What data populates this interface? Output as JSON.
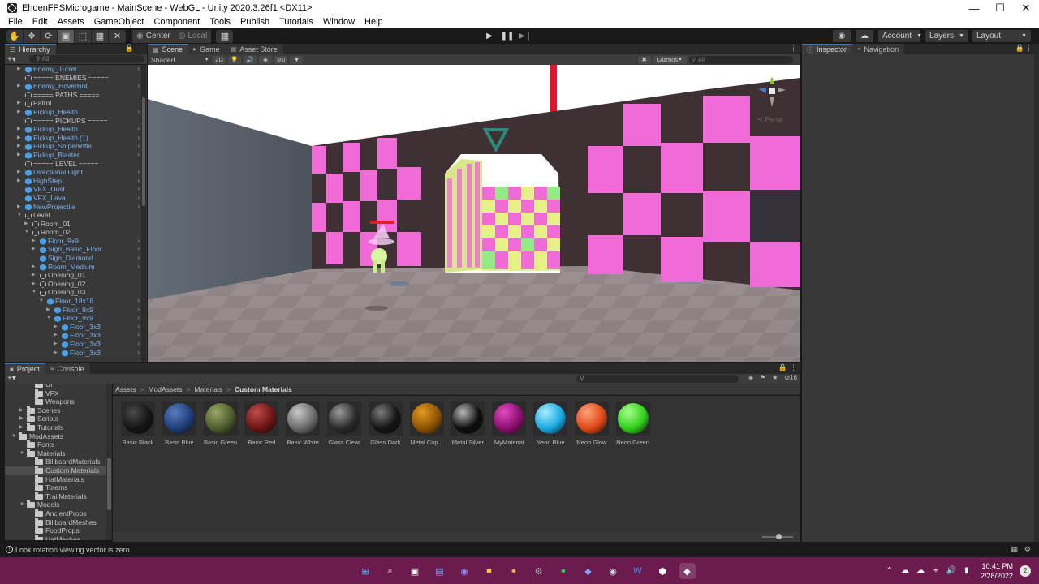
{
  "window": {
    "title": "EhdenFPSMicrogame - MainScene - WebGL - Unity 2020.3.26f1 <DX11>",
    "controls": [
      "minimize",
      "maximize",
      "close"
    ]
  },
  "menubar": [
    "File",
    "Edit",
    "Assets",
    "GameObject",
    "Component",
    "Tools",
    "Publish",
    "Tutorials",
    "Window",
    "Help"
  ],
  "toolbar": {
    "pivot_label": "Center",
    "space_label": "Local",
    "account_label": "Account",
    "layers_label": "Layers",
    "layout_label": "Layout"
  },
  "hierarchy": {
    "tab_label": "Hierarchy",
    "search_placeholder": "All",
    "items": [
      {
        "label": "Enemy_Turret",
        "depth": 0,
        "prefab": true,
        "expand": "closed",
        "more": true
      },
      {
        "label": "===== ENEMIES =====",
        "depth": 0,
        "prefab": false,
        "expand": "none",
        "more": false
      },
      {
        "label": "Enemy_HoverBot",
        "depth": 0,
        "prefab": true,
        "expand": "closed",
        "more": true
      },
      {
        "label": "===== PATHS =====",
        "depth": 0,
        "prefab": false,
        "expand": "none",
        "more": false
      },
      {
        "label": "Patrol",
        "depth": 0,
        "prefab": false,
        "expand": "closed",
        "more": false
      },
      {
        "label": "Pickup_Health",
        "depth": 0,
        "prefab": true,
        "expand": "closed",
        "more": true
      },
      {
        "label": "===== PICKUPS =====",
        "depth": 0,
        "prefab": false,
        "expand": "none",
        "more": false
      },
      {
        "label": "Pickup_Health",
        "depth": 0,
        "prefab": true,
        "expand": "closed",
        "more": true
      },
      {
        "label": "Pickup_Health (1)",
        "depth": 0,
        "prefab": true,
        "expand": "closed",
        "more": true
      },
      {
        "label": "Pickup_SniperRifle",
        "depth": 0,
        "prefab": true,
        "expand": "closed",
        "more": true
      },
      {
        "label": "Pickup_Blaster",
        "depth": 0,
        "prefab": true,
        "expand": "closed",
        "more": true
      },
      {
        "label": "===== LEVEL =====",
        "depth": 0,
        "prefab": false,
        "expand": "none",
        "more": false
      },
      {
        "label": "Directional Light",
        "depth": 0,
        "prefab": true,
        "expand": "closed",
        "more": true
      },
      {
        "label": "HighStep",
        "depth": 0,
        "prefab": true,
        "expand": "closed",
        "more": true
      },
      {
        "label": "VFX_Dust",
        "depth": 0,
        "prefab": true,
        "expand": "none",
        "more": true
      },
      {
        "label": "VFX_Lava",
        "depth": 0,
        "prefab": true,
        "expand": "none",
        "more": true
      },
      {
        "label": "NewProjectile",
        "depth": 0,
        "prefab": true,
        "expand": "closed",
        "more": true
      },
      {
        "label": "Level",
        "depth": 0,
        "prefab": false,
        "expand": "open",
        "more": false
      },
      {
        "label": "Room_01",
        "depth": 1,
        "prefab": false,
        "expand": "closed",
        "more": false
      },
      {
        "label": "Room_02",
        "depth": 1,
        "prefab": false,
        "expand": "open",
        "more": false
      },
      {
        "label": "Floor_9x9",
        "depth": 2,
        "prefab": true,
        "expand": "closed",
        "more": true
      },
      {
        "label": "Sign_Basic_Floor",
        "depth": 2,
        "prefab": true,
        "expand": "closed",
        "more": true
      },
      {
        "label": "Sign_Diamond",
        "depth": 2,
        "prefab": true,
        "expand": "none",
        "more": true
      },
      {
        "label": "Room_Medium",
        "depth": 2,
        "prefab": true,
        "expand": "closed",
        "more": true
      },
      {
        "label": "Opening_01",
        "depth": 2,
        "prefab": false,
        "expand": "closed",
        "more": false
      },
      {
        "label": "Opening_02",
        "depth": 2,
        "prefab": false,
        "expand": "closed",
        "more": false
      },
      {
        "label": "Opening_03",
        "depth": 2,
        "prefab": false,
        "expand": "open",
        "more": false
      },
      {
        "label": "Floor_18x18",
        "depth": 3,
        "prefab": true,
        "expand": "open",
        "more": true
      },
      {
        "label": "Floor_9x9",
        "depth": 4,
        "prefab": true,
        "expand": "closed",
        "more": true
      },
      {
        "label": "Floor_9x9",
        "depth": 4,
        "prefab": true,
        "expand": "open",
        "more": true
      },
      {
        "label": "Floor_3x3",
        "depth": 5,
        "prefab": true,
        "expand": "closed",
        "more": true
      },
      {
        "label": "Floor_3x3",
        "depth": 5,
        "prefab": true,
        "expand": "closed",
        "more": true
      },
      {
        "label": "Floor_3x3",
        "depth": 5,
        "prefab": true,
        "expand": "closed",
        "more": true
      },
      {
        "label": "Floor_3x3",
        "depth": 5,
        "prefab": true,
        "expand": "closed",
        "more": true
      }
    ]
  },
  "scene": {
    "tabs": [
      {
        "label": "Scene",
        "icon": "scene-icon",
        "active": true
      },
      {
        "label": "Game",
        "icon": "game-icon",
        "active": false
      },
      {
        "label": "Asset Store",
        "icon": "store-icon",
        "active": false
      }
    ],
    "shading_mode": "Shaded",
    "mode_2d": "2D",
    "hidden_count": "0",
    "gizmos_label": "Gizmos",
    "search_placeholder": "All",
    "view_label": "Persp"
  },
  "inspector": {
    "tabs": [
      {
        "label": "Inspector",
        "icon": "info-icon",
        "active": true
      },
      {
        "label": "Navigation",
        "icon": "navigation-icon",
        "active": false
      }
    ]
  },
  "project": {
    "tabs": [
      {
        "label": "Project",
        "icon": "folder-icon",
        "active": true
      },
      {
        "label": "Console",
        "icon": "console-icon",
        "active": false
      }
    ],
    "hidden_count": "16",
    "breadcrumb": [
      "Assets",
      "ModAssets",
      "Materials",
      "Custom Materials"
    ],
    "tree": [
      {
        "label": "UI",
        "depth": 2,
        "expand": "none",
        "selected": false
      },
      {
        "label": "VFX",
        "depth": 2,
        "expand": "none",
        "selected": false
      },
      {
        "label": "Weapons",
        "depth": 2,
        "expand": "none",
        "selected": false
      },
      {
        "label": "Scenes",
        "depth": 1,
        "expand": "closed",
        "selected": false
      },
      {
        "label": "Scripts",
        "depth": 1,
        "expand": "closed",
        "selected": false
      },
      {
        "label": "Tutorials",
        "depth": 1,
        "expand": "closed",
        "selected": false
      },
      {
        "label": "ModAssets",
        "depth": 0,
        "expand": "open",
        "selected": false
      },
      {
        "label": "Fonts",
        "depth": 1,
        "expand": "none",
        "selected": false
      },
      {
        "label": "Materials",
        "depth": 1,
        "expand": "open",
        "selected": false
      },
      {
        "label": "BillboardMaterials",
        "depth": 2,
        "expand": "none",
        "selected": false
      },
      {
        "label": "Custom Materials",
        "depth": 2,
        "expand": "none",
        "selected": true
      },
      {
        "label": "HatMaterials",
        "depth": 2,
        "expand": "none",
        "selected": false
      },
      {
        "label": "Totems",
        "depth": 2,
        "expand": "none",
        "selected": false
      },
      {
        "label": "TrailMaterials",
        "depth": 2,
        "expand": "none",
        "selected": false
      },
      {
        "label": "Models",
        "depth": 1,
        "expand": "open",
        "selected": false
      },
      {
        "label": "AncientProps",
        "depth": 2,
        "expand": "none",
        "selected": false
      },
      {
        "label": "BillboardMeshes",
        "depth": 2,
        "expand": "none",
        "selected": false
      },
      {
        "label": "FoodProps",
        "depth": 2,
        "expand": "none",
        "selected": false
      },
      {
        "label": "HatMeshes",
        "depth": 2,
        "expand": "none",
        "selected": false
      }
    ],
    "materials": [
      {
        "label": "Basic Black",
        "color": "#141414",
        "highlight": "#4a4a4a"
      },
      {
        "label": "Basic Blue",
        "color": "#1f3d78",
        "highlight": "#5a7cc0"
      },
      {
        "label": "Basic Green",
        "color": "#4d5a2c",
        "highlight": "#9aa866"
      },
      {
        "label": "Basic Red",
        "color": "#6a1414",
        "highlight": "#c24b4b"
      },
      {
        "label": "Basic White",
        "color": "#6a6a6a",
        "highlight": "#c8c8c8"
      },
      {
        "label": "Glass Clear",
        "color": "#2a2a2a",
        "highlight": "#9a9a9a"
      },
      {
        "label": "Glass Dark",
        "color": "#141414",
        "highlight": "#7a7a7a"
      },
      {
        "label": "Metal Cop...",
        "color": "#8a5200",
        "highlight": "#e39a22"
      },
      {
        "label": "Metal Silver",
        "color": "#0e0e0e",
        "highlight": "#b8b8b8"
      },
      {
        "label": "MyMaterial",
        "color": "#8a0f6e",
        "highlight": "#e04ac0"
      },
      {
        "label": "Neon Blue",
        "color": "#18a8e0",
        "highlight": "#a8ecff"
      },
      {
        "label": "Neon Glow",
        "color": "#e04818",
        "highlight": "#ffa27a"
      },
      {
        "label": "Neon Green",
        "color": "#2fcf1a",
        "highlight": "#a6ff8a"
      }
    ]
  },
  "status": {
    "message": "Look rotation viewing vector is zero"
  },
  "taskbar": {
    "apps": [
      "windows-start-icon",
      "search-icon",
      "task-view-icon",
      "widgets-icon",
      "teams-chat-icon",
      "file-explorer-icon",
      "chrome-icon",
      "settings-icon",
      "spotify-icon",
      "discord-icon",
      "steam-icon",
      "word-icon",
      "unity-hub-icon",
      "unity-editor-icon"
    ],
    "time": "10:41 PM",
    "date": "2/28/2022",
    "notification_count": "2",
    "colors": {
      "background": "#6b1b4d"
    }
  },
  "colors": {
    "editor_bg": "#191919",
    "panel_bg": "#383838",
    "prefab_text": "#7cb2ee",
    "checker_pink": "#f06bd8",
    "checker_dark": "#3f3133",
    "wall_grey": "#5e6670",
    "floor_grey": "#928788",
    "enemy_green": "#d8f5a0"
  }
}
